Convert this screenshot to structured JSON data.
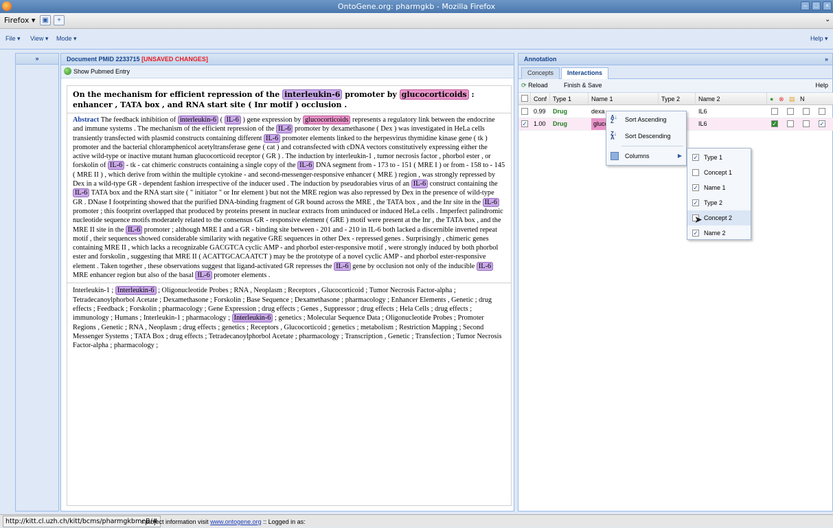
{
  "window": {
    "title": "OntoGene.org: pharmgkb - Mozilla Firefox"
  },
  "browser": {
    "menu_label": "Firefox",
    "new_tab": "+"
  },
  "app_menu": {
    "file": "File ▾",
    "view": "View ▾",
    "mode": "Mode ▾",
    "help": "Help ▾"
  },
  "left_strip": {
    "expand": "»"
  },
  "document": {
    "header_prefix": "Document PMID 2233715",
    "unsaved": "[UNSAVED CHANGES]",
    "show_pubmed": "Show Pubmed Entry",
    "title": [
      {
        "t": "On the mechanism for efficient repression of the "
      },
      {
        "t": "interleukin-6",
        "c": "p"
      },
      {
        "t": " promoter by "
      },
      {
        "t": "glucocorticoids",
        "c": "m"
      },
      {
        "t": " : enhancer , TATA box , and RNA start site ( Inr motif ) occlusion ."
      }
    ],
    "abstract_label": "Abstract",
    "abstract": [
      {
        "t": " The feedback inhibition of "
      },
      {
        "t": "interleukin-6",
        "c": "p"
      },
      {
        "t": " ( "
      },
      {
        "t": "IL-6",
        "c": "p"
      },
      {
        "t": " ) gene expression by "
      },
      {
        "t": "glucocorticoids",
        "c": "m"
      },
      {
        "t": " represents a regulatory link between the endocrine and immune systems . The mechanism of the efficient repression of the "
      },
      {
        "t": "IL-6",
        "c": "p"
      },
      {
        "t": " promoter by dexamethasone ( Dex ) was investigated in HeLa cells transiently transfected with plasmid constructs containing different "
      },
      {
        "t": "IL-6",
        "c": "p"
      },
      {
        "t": " promoter elements linked to the herpesvirus thymidine kinase gene ( tk ) promoter and the bacterial chloramphenicol acetyltransferase gene ( cat ) and cotransfected with cDNA vectors constitutively expressing either the active wild-type or inactive mutant human glucocorticoid receptor ( GR ) . The induction by interleukin-1 , tumor necrosis factor , phorbol ester , or forskolin of "
      },
      {
        "t": "IL-6",
        "c": "p"
      },
      {
        "t": " - tk - cat chimeric constructs containing a single copy of the "
      },
      {
        "t": "IL-6",
        "c": "p"
      },
      {
        "t": " DNA segment from - 173 to - 151 ( MRE I ) or from - 158 to - 145 ( MRE II ) , which derive from within the multiple cytokine - and second-messenger-responsive enhancer ( MRE ) region , was strongly repressed by Dex in a wild-type GR - dependent fashion irrespective of the inducer used . The induction by pseudorabies virus of an "
      },
      {
        "t": "IL-6",
        "c": "p"
      },
      {
        "t": " construct containing the "
      },
      {
        "t": "IL-6",
        "c": "p"
      },
      {
        "t": " TATA box and the RNA start site ( \" initiator \" or Inr element ) but not the MRE region was also repressed by Dex in the presence of wild-type GR . DNase I footprinting showed that the purified DNA-binding fragment of GR bound across the MRE , the TATA box , and the Inr site in the "
      },
      {
        "t": "IL-6",
        "c": "p"
      },
      {
        "t": " promoter ; this footprint overlapped that produced by proteins present in nuclear extracts from uninduced or induced HeLa cells . Imperfect palindromic nucleotide sequence motifs moderately related to the consensus GR - responsive element ( GRE ) motif were present at the Inr , the TATA box , and the MRE II site in the "
      },
      {
        "t": "IL-6",
        "c": "p"
      },
      {
        "t": " promoter ; although MRE I and a GR - binding site between - 201 and - 210 in IL-6 both lacked a discernible inverted repeat motif , their sequences showed considerable similarity with negative GRE sequences in other Dex - repressed genes . Surprisingly , chimeric genes containing MRE II , which lacks a recognizable GACGTCA cyclic AMP - and phorbol ester-responsive motif , were strongly induced by both phorbol ester and forskolin , suggesting that MRE II ( ACATTGCACAATCT ) may be the prototype of a novel cyclic AMP - and phorbol ester-responsive element . Taken together , these observations suggest that ligand-activated GR represses the "
      },
      {
        "t": "IL-6",
        "c": "p"
      },
      {
        "t": " gene by occlusion not only of the inducible "
      },
      {
        "t": "IL-6",
        "c": "p"
      },
      {
        "t": " MRE enhancer region but also of the basal "
      },
      {
        "t": "IL-6",
        "c": "p"
      },
      {
        "t": " promoter elements ."
      }
    ],
    "mesh": [
      {
        "t": "Interleukin-1 ; "
      },
      {
        "t": "Interleukin-6",
        "c": "p"
      },
      {
        "t": " ; Oligonucleotide Probes ; RNA , Neoplasm ; Receptors , Glucocorticoid ; Tumor Necrosis Factor-alpha ; Tetradecanoylphorbol Acetate ; Dexamethasone ; Forskolin ; Base Sequence ; Dexamethasone ; pharmacology ; Enhancer Elements , Genetic ; drug effects ; Feedback ; Forskolin ; pharmacology ; Gene Expression ; drug effects ; Genes , Suppressor ; drug effects ; Hela Cells ; drug effects ; immunology ; Humans ; Interleukin-1 ; pharmacology ; "
      },
      {
        "t": "Interleukin-6",
        "c": "p"
      },
      {
        "t": " ; genetics ; Molecular Sequence Data ; Oligonucleotide Probes ; Promoter Regions , Genetic ; RNA , Neoplasm ; drug effects ; genetics ; Receptors , Glucocorticoid ; genetics ; metabolism ; Restriction Mapping ; Second Messenger Systems ; TATA Box ; drug effects ; Tetradecanoylphorbol Acetate ; pharmacology ; Transcription , Genetic ; Transfection ; Tumor Necrosis Factor-alpha ; pharmacology ;"
      }
    ]
  },
  "annotation": {
    "header": "Annotation",
    "collapse": "»",
    "tabs": [
      "Concepts",
      "Interactions"
    ],
    "toolbar": {
      "reload": "Reload",
      "finish": "Finish & Save",
      "help": "Help"
    },
    "columns": {
      "conf": "Conf",
      "type1": "Type 1",
      "name1": "Name 1",
      "type2": "Type 2",
      "name2": "Name 2",
      "n": "N"
    },
    "rows": [
      {
        "checked": false,
        "conf": "0.99",
        "type1": "Drug",
        "name1": "dexa",
        "name2": "IL6",
        "flags": [
          false,
          false,
          false,
          false
        ]
      },
      {
        "checked": true,
        "conf": "1.00",
        "type1": "Drug",
        "name1": "glucc",
        "name2": "IL6",
        "flags": [
          true,
          false,
          false,
          true
        ]
      }
    ],
    "context_menu": {
      "asc": "Sort Ascending",
      "desc": "Sort Descending",
      "columns": "Columns"
    },
    "columns_menu": [
      {
        "label": "Type 1",
        "checked": true
      },
      {
        "label": "Concept 1",
        "checked": false
      },
      {
        "label": "Name 1",
        "checked": true
      },
      {
        "label": "Type 2",
        "checked": true
      },
      {
        "label": "Concept 2",
        "checked": false
      },
      {
        "label": "Name 2",
        "checked": true
      }
    ]
  },
  "status": {
    "url": "http://kitt.cl.uzh.ch/kitt/bcms/pharmgkbmeB/#",
    "info_prefix": "r project information visit",
    "link": "www.ontogene.org",
    "info_suffix": ":: Logged in as:"
  },
  "colors": {
    "protein_highlight": "#c9a9e8",
    "chemical_highlight": "#e994c9",
    "unsaved": "#e8181d"
  }
}
